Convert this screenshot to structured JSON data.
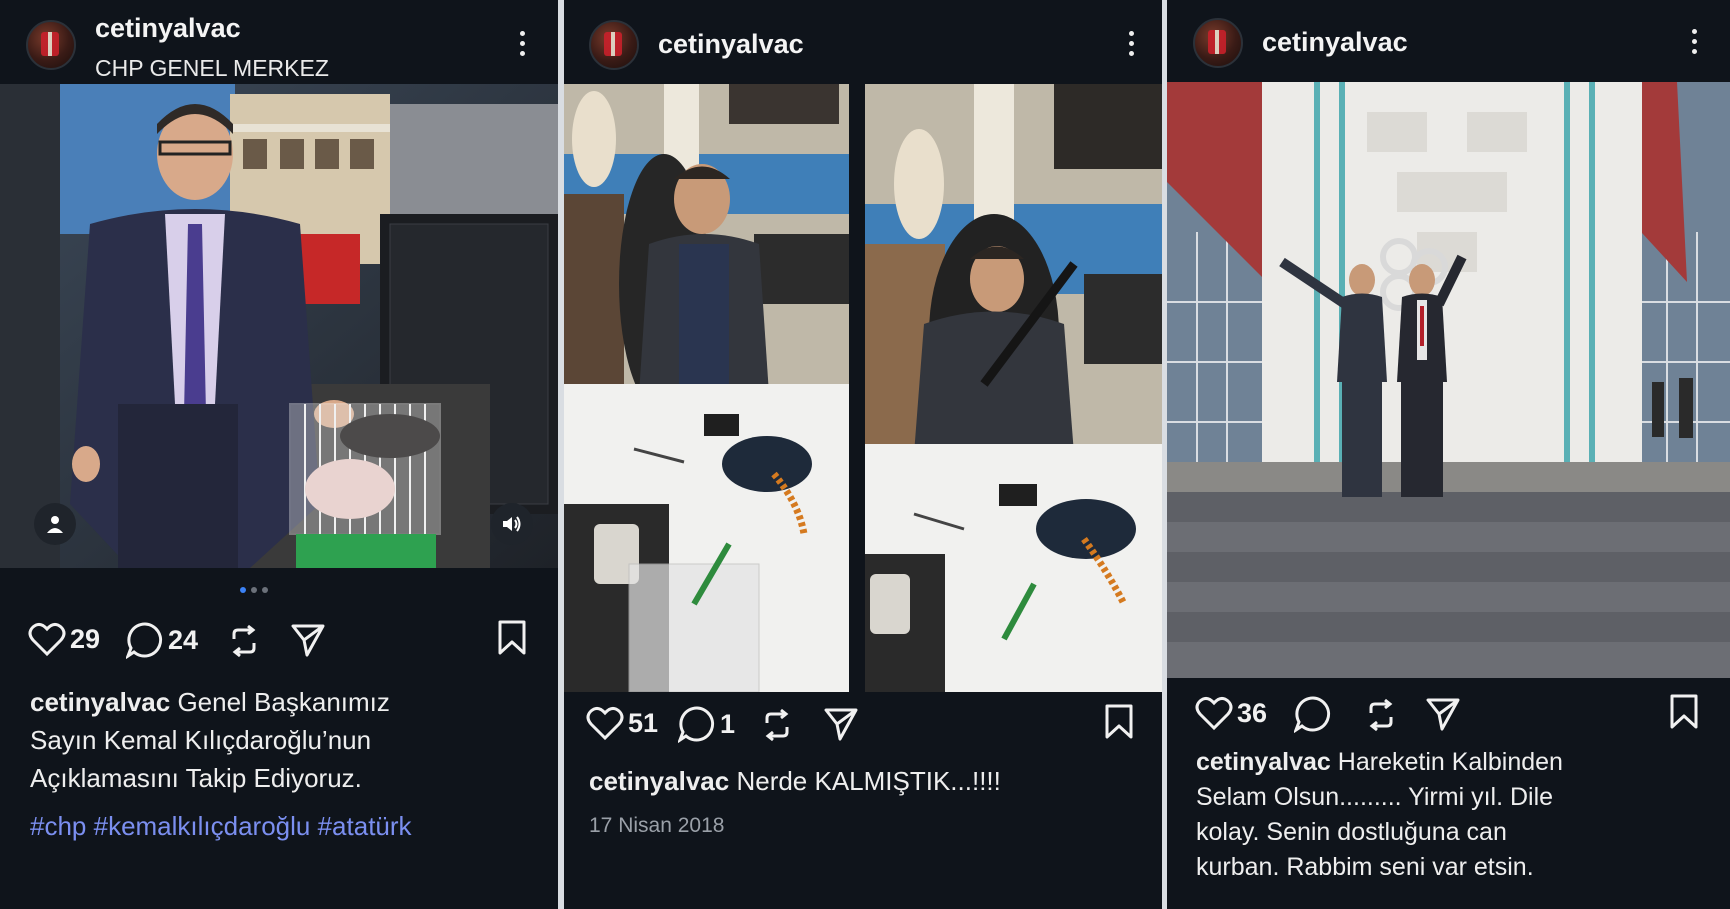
{
  "posts": [
    {
      "username": "cetinyalvac",
      "location": "CHP GENEL MERKEZ",
      "likes": "29",
      "comments": "24",
      "caption_user": "cetinyalvac",
      "caption_text": "Genel Başkanımız Sayın Kemal Kılıçdaroğlu’nun Açıklamasını Takip Ediyoruz.",
      "hashtags": "#chp #kemalkılıçdaroğlu #atatürk",
      "carousel": {
        "count": 3,
        "active": 1
      }
    },
    {
      "username": "cetinyalvac",
      "likes": "51",
      "comments": "1",
      "caption_user": "cetinyalvac",
      "caption_text": "Nerde KALMIŞTIK...!!!!",
      "date": "17 Nisan 2018"
    },
    {
      "username": "cetinyalvac",
      "likes": "36",
      "caption_user": "cetinyalvac",
      "caption_text": "Hareketin Kalbinden Selam Olsun......... Yirmi yıl. Dile kolay. Senin dostluğuna can kurban. Rabbim seni var etsin."
    }
  ],
  "icons": {
    "like": "heart-icon",
    "comment": "comment-bubble-icon",
    "repost": "repost-icon",
    "share": "send-icon",
    "save": "bookmark-icon",
    "more": "more-vertical-icon",
    "tag": "user-tag-icon",
    "sound": "speaker-icon"
  },
  "colors": {
    "hashtag": "#7b8ff0",
    "background": "#0f141b",
    "active_dot": "#3b82f6"
  }
}
